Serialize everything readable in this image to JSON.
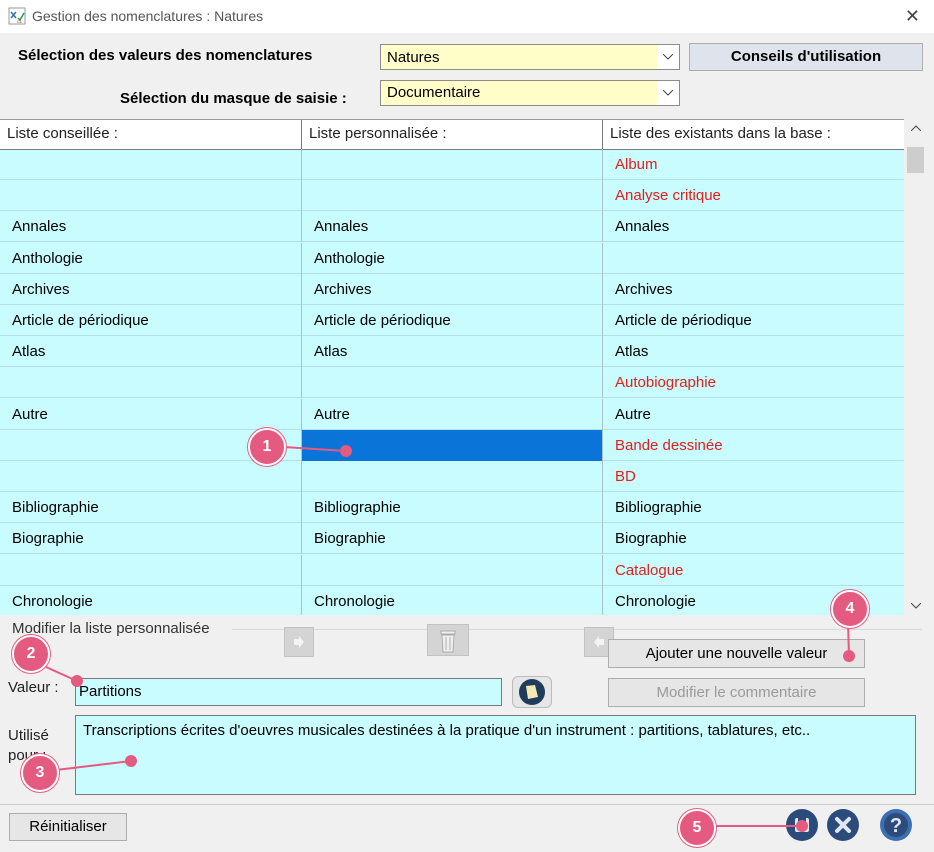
{
  "window": {
    "title": "Gestion des nomenclatures :  Natures"
  },
  "top": {
    "nomenclature_label": "Sélection des valeurs des nomenclatures",
    "nomenclature_value": "Natures",
    "mask_label": "Sélection du masque de saisie :",
    "mask_value": "Documentaire",
    "advice_button": "Conseils d'utilisation"
  },
  "grid": {
    "headers": [
      "Liste conseillée :",
      "Liste personnalisée :",
      "Liste des existants dans la base :"
    ],
    "rows": [
      {
        "c1": "",
        "c2": "",
        "c3": "Album",
        "c3_red": true
      },
      {
        "c1": "",
        "c2": "",
        "c3": "Analyse critique",
        "c3_red": true
      },
      {
        "c1": "Annales",
        "c2": "Annales",
        "c3": "Annales"
      },
      {
        "c1": "Anthologie",
        "c2": "Anthologie",
        "c3": ""
      },
      {
        "c1": "Archives",
        "c2": "Archives",
        "c3": "Archives"
      },
      {
        "c1": "Article de périodique",
        "c2": "Article de périodique",
        "c3": "Article de périodique"
      },
      {
        "c1": "Atlas",
        "c2": "Atlas",
        "c3": "Atlas"
      },
      {
        "c1": "",
        "c2": "",
        "c3": "Autobiographie",
        "c3_red": true
      },
      {
        "c1": "Autre",
        "c2": "Autre",
        "c3": "Autre"
      },
      {
        "c1": "",
        "c2": "",
        "c3": "Bande dessinée",
        "c3_red": true,
        "c2_selected": true
      },
      {
        "c1": "",
        "c2": "",
        "c3": "BD",
        "c3_red": true
      },
      {
        "c1": "Bibliographie",
        "c2": "Bibliographie",
        "c3": "Bibliographie"
      },
      {
        "c1": "Biographie",
        "c2": "Biographie",
        "c3": "Biographie"
      },
      {
        "c1": "",
        "c2": "",
        "c3": "Catalogue",
        "c3_red": true
      },
      {
        "c1": "Chronologie",
        "c2": "Chronologie",
        "c3": "Chronologie"
      }
    ],
    "red_color": "#e0201d",
    "cell_color": "#c8fcff",
    "selection_color": "#0a74d8"
  },
  "edit": {
    "section_title": "Modifier la liste personnalisée",
    "add_button": "Ajouter une nouvelle valeur",
    "modify_comment_button": "Modifier le commentaire",
    "value_label": "Valeur :",
    "value": "Partitions",
    "used_for_label_1": "Utilisé",
    "used_for_label_2": "pour :",
    "used_for_text": "Transcriptions écrites d'oeuvres musicales destinées à la pratique d'un instrument : partitions, tablatures, etc.."
  },
  "footer": {
    "reset_button": "Réinitialiser"
  },
  "annotations": [
    "1",
    "2",
    "3",
    "4",
    "5"
  ],
  "annotation_color": "#e55a80"
}
